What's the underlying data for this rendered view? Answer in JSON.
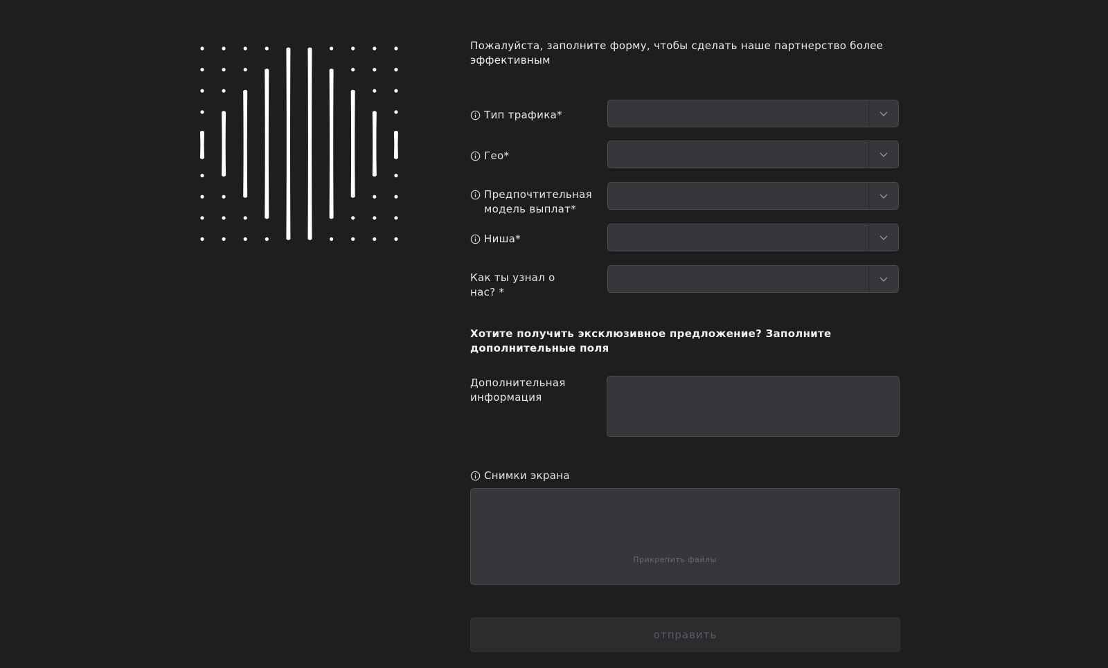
{
  "intro": "Пожалуйста, заполните форму, чтобы сделать наше партнерство более эффективным",
  "fields": [
    {
      "label": "Тип трафика*",
      "has_info_icon": true,
      "value": ""
    },
    {
      "label": "Гео*",
      "has_info_icon": true,
      "value": ""
    },
    {
      "label": "Предпочтительная модель выплат*",
      "has_info_icon": true,
      "value": ""
    },
    {
      "label": "Ниша*",
      "has_info_icon": true,
      "value": ""
    },
    {
      "label": "Как ты узнал о нас? *",
      "has_info_icon": false,
      "value": ""
    }
  ],
  "extra_heading": "Хотите получить эксклюзивное предложение? Заполните дополнительные поля",
  "additional_info": {
    "label": "Дополнительная информация",
    "value": ""
  },
  "screenshots": {
    "label": "Снимки экрана",
    "hint": "Прикрепить файлы"
  },
  "submit_label": "отправить",
  "icons": {
    "info": "info-circle-icon",
    "dropdown": "chevron-down-icon"
  },
  "colors": {
    "background": "#1e1e1e",
    "field_bg": "#36373a",
    "text": "#ececec",
    "submit_disabled_bg": "#2b2c2e"
  }
}
